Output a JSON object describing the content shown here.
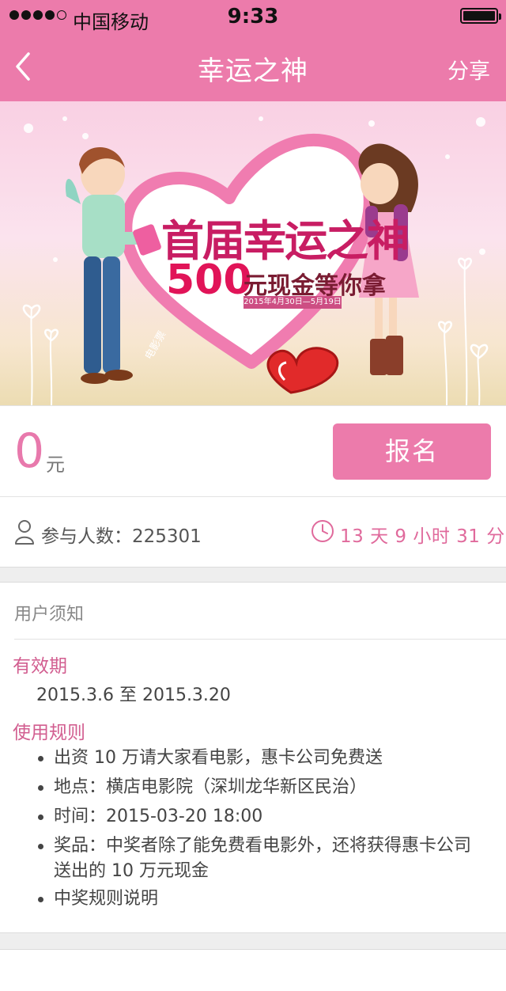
{
  "status_bar": {
    "carrier": "中国移动",
    "time": "9:33",
    "signal_bars_filled": 4,
    "signal_bars_total": 5
  },
  "nav": {
    "title": "幸运之神",
    "share_label": "分享",
    "back_icon": "chevron-left-icon"
  },
  "banner": {
    "title": "首届幸运之神",
    "amount": "500",
    "subtitle": "元现金等你拿",
    "date_range": "2015年4月30日—5月19日",
    "ticket_text": "电影票"
  },
  "price": {
    "value": "0",
    "unit": "元"
  },
  "signup_button": "报名",
  "stats": {
    "participants": "参与人数：225301",
    "countdown": "13 天 9 小时 31 分"
  },
  "notice": {
    "title": "用户须知",
    "validity_heading": "有效期",
    "validity_text": "2015.3.6 至 2015.3.20",
    "rules_heading": "使用规则",
    "rules": [
      "出资 10 万请大家看电影，惠卡公司免费送",
      "地点：横店电影院（深圳龙华新区民治）",
      "时间：2015-03-20 18:00",
      "奖品：中奖者除了能免费看电影外，还将获得惠卡公司送出的 10 万元现金",
      "中奖规则说明"
    ]
  },
  "colors": {
    "accent": "#ec7bab",
    "accent_text": "#d25e90",
    "background_gap": "#eeeeee"
  }
}
